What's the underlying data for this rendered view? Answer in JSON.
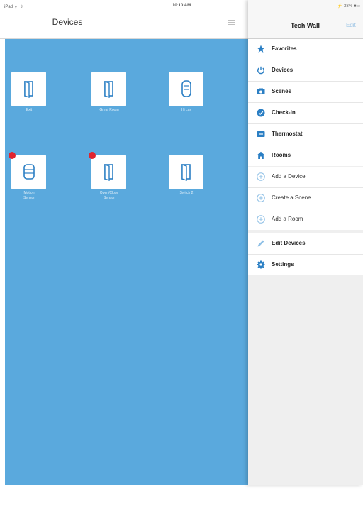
{
  "status_bar": {
    "left": "iPad ᯤ ☽",
    "time": "10:10 AM",
    "right": "⚡ 38% ■▭"
  },
  "nav": {
    "title": "Devices"
  },
  "devices": [
    {
      "label": "Exit",
      "alert": false,
      "icon": "door-icon"
    },
    {
      "label": "Great Room",
      "alert": false,
      "icon": "door-icon"
    },
    {
      "label": "Hi Lux",
      "alert": false,
      "icon": "sensor-icon"
    },
    {
      "label": "Motion\nSensor",
      "alert": true,
      "icon": "sensor-icon"
    },
    {
      "label": "Open/Close\nSensor",
      "alert": true,
      "icon": "door-icon"
    },
    {
      "label": "Switch 2",
      "alert": false,
      "icon": "door-icon"
    }
  ],
  "drawer": {
    "title": "Tech Wall",
    "edit_label": "Edit",
    "nav_items": [
      {
        "label": "Favorites",
        "icon": "star-icon"
      },
      {
        "label": "Devices",
        "icon": "power-icon"
      },
      {
        "label": "Scenes",
        "icon": "scenes-icon"
      },
      {
        "label": "Check-In",
        "icon": "checkin-icon"
      },
      {
        "label": "Thermostat",
        "icon": "thermostat-icon"
      },
      {
        "label": "Rooms",
        "icon": "home-icon"
      }
    ],
    "add_items": [
      {
        "label": "Add a Device",
        "icon": "plus-circle-icon"
      },
      {
        "label": "Create a Scene",
        "icon": "plus-circle-icon"
      },
      {
        "label": "Add a Room",
        "icon": "plus-circle-icon"
      }
    ],
    "settings_items": [
      {
        "label": "Edit Devices",
        "icon": "pencil-icon"
      },
      {
        "label": "Settings",
        "icon": "gear-icon"
      }
    ]
  },
  "colors": {
    "grid_bg": "#5aa9dd",
    "accent": "#2b7fc4",
    "alert": "#e0242f"
  }
}
